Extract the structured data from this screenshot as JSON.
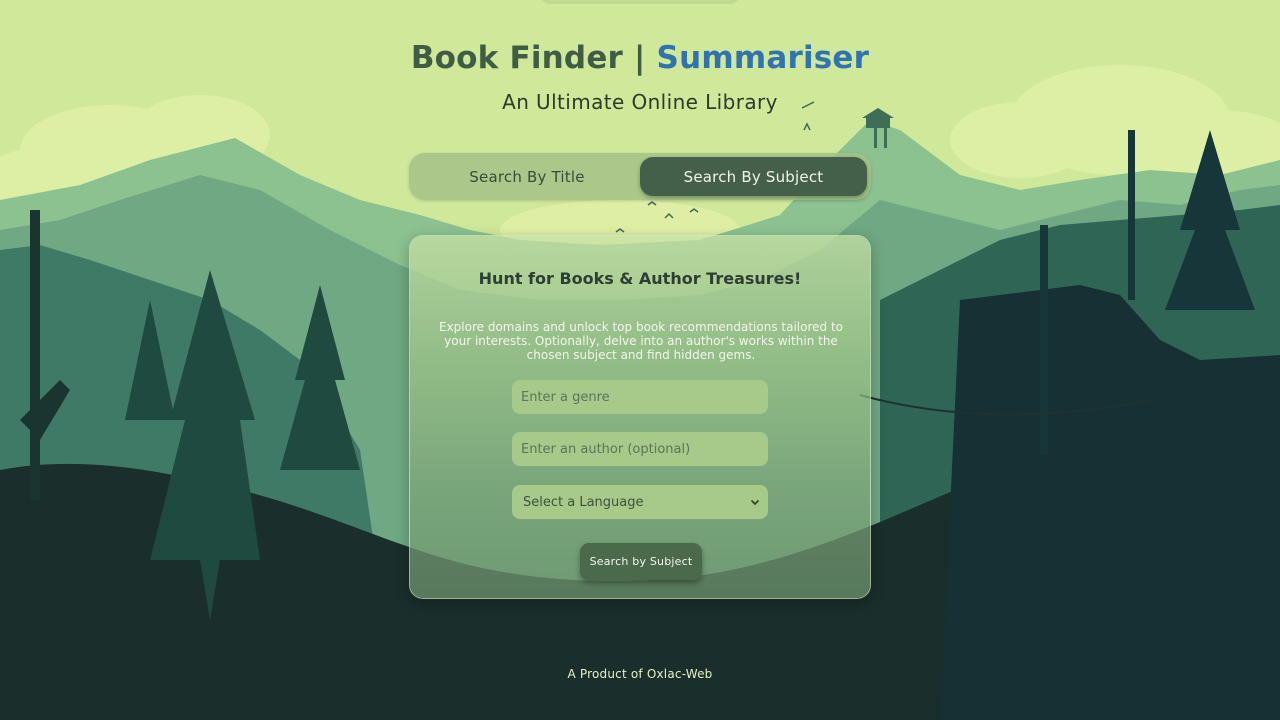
{
  "header": {
    "title_main": "Book Finder | ",
    "title_accent": "Summariser",
    "subtitle": "An Ultimate Online Library"
  },
  "tabs": [
    {
      "label": "Search By Title",
      "active": false
    },
    {
      "label": "Search By Subject",
      "active": true
    }
  ],
  "card": {
    "heading": "Hunt for Books & Author Treasures!",
    "description": "Explore domains and unlock top book recommendations tailored to your interests. Optionally, delve into an author's works within the chosen subject and find hidden gems.",
    "genre_placeholder": "Enter a genre",
    "author_placeholder": "Enter an author (optional)",
    "language_select": "Select a Language",
    "submit_label": "Search by Subject"
  },
  "footer": {
    "text": "A Product of Oxlac-Web"
  },
  "colors": {
    "accent": "#2f73b0",
    "title": "#3f5d44",
    "active_tab": "#44604a",
    "sky": "#cfe89a"
  },
  "icons": {
    "select_arrow": "chevron-down-icon"
  }
}
